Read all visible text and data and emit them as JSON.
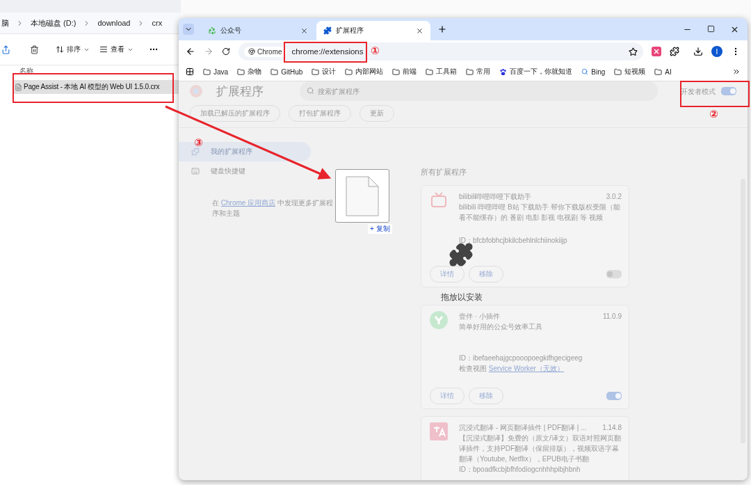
{
  "explorer": {
    "breadcrumbs": [
      "脑",
      "本地磁盘 (D:)",
      "download",
      "crx"
    ],
    "toolbar": {
      "sort_label": "排序",
      "view_label": "查看"
    },
    "column_header": "名称",
    "files": [
      {
        "name": "Page Assist - 本地 AI 模型的 Web UI 1.5.0.crx",
        "selected": true
      }
    ]
  },
  "browser": {
    "tabs": [
      {
        "title": "公众号",
        "kind": "site",
        "selected": false
      },
      {
        "title": "扩展程序",
        "kind": "extensions",
        "selected": true
      }
    ],
    "address": {
      "chip": "Chrome",
      "url": "chrome://extensions"
    },
    "profile_initial": "I",
    "bookmarks": [
      {
        "label": "Java",
        "kind": "folder"
      },
      {
        "label": "杂物",
        "kind": "folder"
      },
      {
        "label": "GitHub",
        "kind": "folder"
      },
      {
        "label": "设计",
        "kind": "folder"
      },
      {
        "label": "内部网站",
        "kind": "folder"
      },
      {
        "label": "前端",
        "kind": "folder"
      },
      {
        "label": "工具箱",
        "kind": "folder"
      },
      {
        "label": "常用",
        "kind": "folder"
      },
      {
        "label": "百度一下，你就知道",
        "kind": "paw"
      },
      {
        "label": "Bing",
        "kind": "search"
      },
      {
        "label": "短视频",
        "kind": "folder"
      },
      {
        "label": "AI",
        "kind": "folder"
      }
    ]
  },
  "extensions_page": {
    "title": "扩展程序",
    "search": {
      "placeholder": "搜索扩展程序"
    },
    "developer_mode": {
      "label": "开发者模式",
      "on": true
    },
    "actions": [
      "加载已解压的扩展程序",
      "打包扩展程序",
      "更新"
    ],
    "sidebar": [
      {
        "label": "我的扩展程序",
        "kind": "puzzle",
        "selected": true
      },
      {
        "label": "键盘快捷键",
        "kind": "keyboard",
        "selected": false
      }
    ],
    "promo": {
      "before": "在 ",
      "link": "Chrome 应用商店",
      "after": " 中发现更多扩展程序和主题"
    },
    "section_title": "所有扩展程序",
    "extensions": [
      {
        "name": "bilibili哔哩哔哩下载助手",
        "version": "3.0.2",
        "kind": "tv",
        "description": "bilibili 哔哩哔哩 B站 下载助手 帮你下载版权受限（能看不能缓存）的 番剧 电影 影视 电视剧 等 视频",
        "id": "ID：bfcbfobhcjbkilcbehlnlchiinokiijp",
        "buttons": [
          "详情",
          "移除"
        ],
        "enabled": false
      },
      {
        "name": "壹伴 · 小插件",
        "version": "11.0.9",
        "kind": "y",
        "description": "简单好用的公众号效率工具",
        "id": "ID：ibefaeehajgcpooopoegkifhgecigeeg",
        "inspect": {
          "label": "检查视图",
          "link": "Service Worker（无效）"
        },
        "buttons": [
          "详情",
          "移除"
        ],
        "enabled": true
      },
      {
        "name": "沉浸式翻译 - 网页翻译插件 | PDF翻译 | ...",
        "version": "1.14.8",
        "kind": "translate",
        "description": "【沉浸式翻译】免费的（原文/译文）双语对照网页翻译插件，支持PDF翻译（保留排版），视频双语字幕翻译（Youtube, Netflix），EPUB电子书翻",
        "id": "ID：bpoadfkcbjbfhfodiogcnhhhpibjhbnh"
      }
    ]
  },
  "drag_overlay": {
    "badge": "+ 复制",
    "caption": "拖放以安装"
  },
  "annotations": [
    "①",
    "②",
    "③"
  ]
}
